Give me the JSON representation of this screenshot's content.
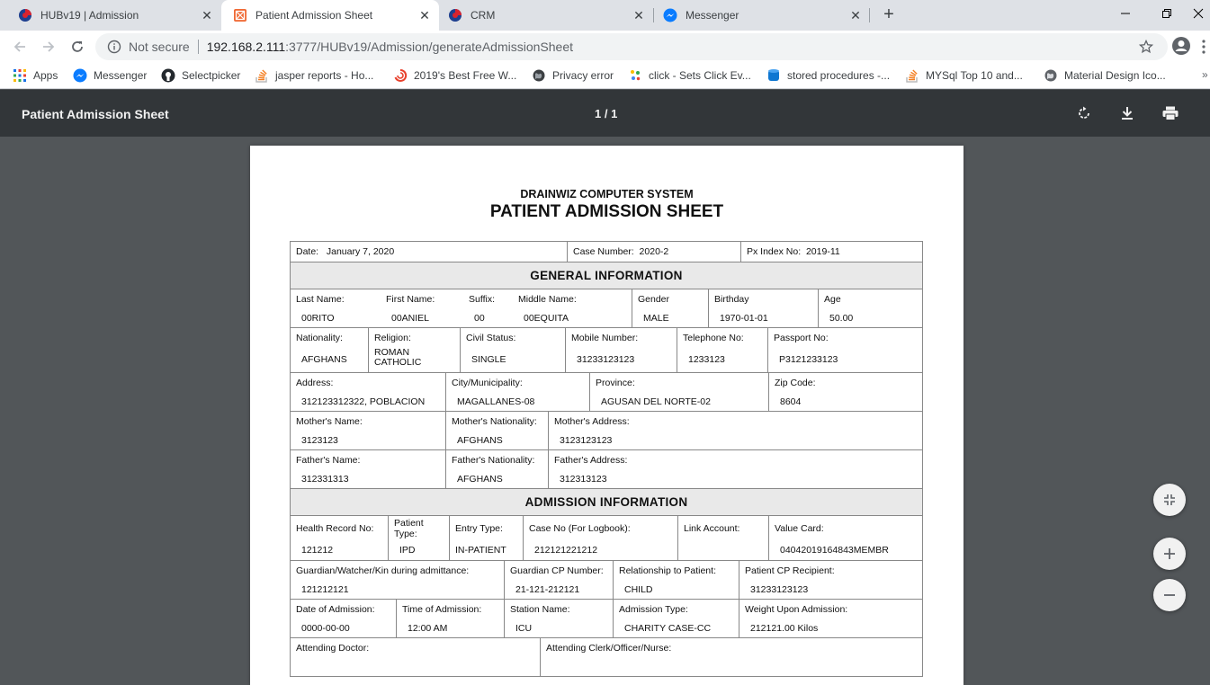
{
  "tabs": [
    {
      "title": "HUBv19 | Admission",
      "close": "✕"
    },
    {
      "title": "Patient Admission Sheet",
      "close": "✕"
    },
    {
      "title": "CRM",
      "close": "✕"
    },
    {
      "title": "Messenger",
      "close": "✕"
    }
  ],
  "new_tab": "+",
  "address": {
    "security": "Not secure",
    "host": "192.168.2.111",
    "path": ":3777/HUBv19/Admission/generateAdmissionSheet"
  },
  "bookmarks": [
    "Apps",
    "Messenger",
    "Selectpicker",
    "jasper reports - Ho...",
    "2019's Best Free W...",
    "Privacy error",
    "click - Sets Click Ev...",
    "stored procedures -...",
    "MYSql Top 10 and...",
    "Material Design Ico..."
  ],
  "bookmarks_more": "»",
  "pdf": {
    "title": "Patient Admission Sheet",
    "pages": "1 / 1"
  },
  "doc": {
    "org": "DRAINWIZ COMPUTER SYSTEM",
    "title": "PATIENT ADMISSION SHEET",
    "header": {
      "date_label": "Date:",
      "date": "January 7, 2020",
      "case_label": "Case Number:",
      "case": "2020-2",
      "px_label": "Px Index No:",
      "px": "2019-11"
    },
    "general_title": "GENERAL INFORMATION",
    "admission_title": "ADMISSION INFORMATION",
    "rows": {
      "r1": [
        {
          "label": "Last Name:",
          "value": "00RITO"
        },
        {
          "label": "First Name:",
          "value": "00ANIEL"
        },
        {
          "label": "Suffix:",
          "value": "00"
        },
        {
          "label": "Middle Name:",
          "value": "00EQUITA"
        },
        {
          "label": "Gender",
          "value": "MALE"
        },
        {
          "label": "Birthday",
          "value": "1970-01-01"
        },
        {
          "label": "Age",
          "value": "50.00"
        }
      ],
      "r2": [
        {
          "label": "Nationality:",
          "value": "AFGHANS"
        },
        {
          "label": "Religion:",
          "value": "ROMAN CATHOLIC"
        },
        {
          "label": "Civil Status:",
          "value": "SINGLE"
        },
        {
          "label": "Mobile Number:",
          "value": "31233123123"
        },
        {
          "label": "Telephone No:",
          "value": "1233123"
        },
        {
          "label": "Passport No:",
          "value": "P3121233123"
        }
      ],
      "r3": [
        {
          "label": "Address:",
          "value": "312123312322, POBLACION"
        },
        {
          "label": "City/Municipality:",
          "value": "MAGALLANES-08"
        },
        {
          "label": "Province:",
          "value": "AGUSAN DEL NORTE-02"
        },
        {
          "label": "Zip Code:",
          "value": "8604"
        }
      ],
      "r4": [
        {
          "label": "Mother's Name:",
          "value": "3123123"
        },
        {
          "label": "Mother's Nationality:",
          "value": "AFGHANS"
        },
        {
          "label": "Mother's Address:",
          "value": "3123123123"
        }
      ],
      "r5": [
        {
          "label": "Father's Name:",
          "value": "312331313"
        },
        {
          "label": "Father's Nationality:",
          "value": "AFGHANS"
        },
        {
          "label": "Father's Address:",
          "value": "312313123"
        }
      ],
      "r6": [
        {
          "label": "Health Record No:",
          "value": "121212"
        },
        {
          "label": "Patient Type:",
          "value": "IPD"
        },
        {
          "label": "Entry Type:",
          "value": "IN-PATIENT"
        },
        {
          "label": "Case No (For Logbook):",
          "value": "212121221212"
        },
        {
          "label": "Link Account:",
          "value": ""
        },
        {
          "label": "Value Card:",
          "value": "04042019164843MEMBR"
        }
      ],
      "r7": [
        {
          "label": "Guardian/Watcher/Kin during admittance:",
          "value": "121212121"
        },
        {
          "label": "Guardian CP Number:",
          "value": "21-121-212121"
        },
        {
          "label": "Relationship to Patient:",
          "value": "CHILD"
        },
        {
          "label": "Patient CP Recipient:",
          "value": "31233123123"
        }
      ],
      "r8": [
        {
          "label": "Date of Admission:",
          "value": "0000-00-00"
        },
        {
          "label": "Time of Admission:",
          "value": "12:00 AM"
        },
        {
          "label": "Station Name:",
          "value": "ICU"
        },
        {
          "label": "Admission Type:",
          "value": "CHARITY CASE-CC"
        },
        {
          "label": "Weight Upon Admission:",
          "value": "212121.00 Kilos"
        }
      ],
      "r9": [
        {
          "label": "Attending Doctor:"
        },
        {
          "label": "Attending Clerk/Officer/Nurse:"
        }
      ]
    }
  }
}
